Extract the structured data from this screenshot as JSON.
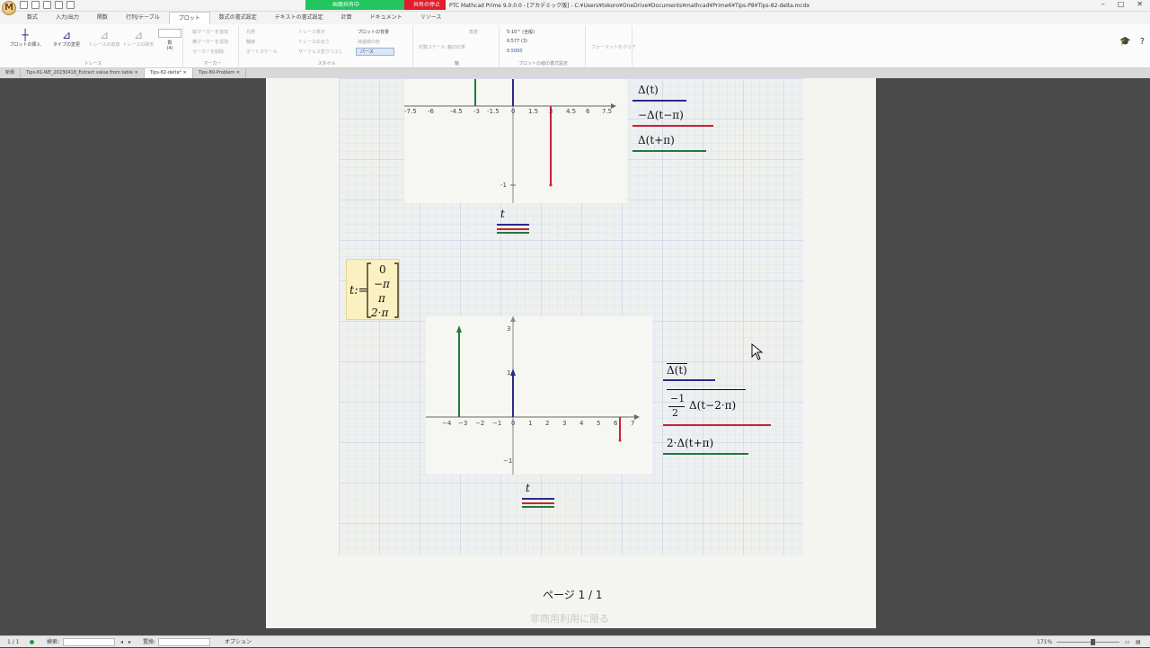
{
  "app": {
    "title": "PTC Mathcad Prime 9.0.0.0 - [アカデミック版] - C:¥Users¥tokoro¥OneDrive¥Documents¥mathcad¥Prime6¥Tips-P8¥Tips-82-delta.mcdx",
    "share_status": "画面共有中",
    "share_stop": "共有の停止"
  },
  "menu": {
    "tabs": [
      "数式",
      "入力/出力",
      "関数",
      "行列/テーブル",
      "プロット",
      "数式の書式設定",
      "テキストの書式設定",
      "計算",
      "ドキュメント",
      "リソース"
    ],
    "active": "プロット"
  },
  "ribbon": {
    "trace": {
      "insert_plot": "プロットの挿入",
      "change_type": "タイプの変更",
      "add_trace": "トレースの追加",
      "delete_trace": "トレースの除去",
      "count_label": "数",
      "count_value": "(4)",
      "group": "トレース"
    },
    "marker": {
      "add_v": "縦マーカーを追加",
      "add_h": "横マーカーを追加",
      "remove": "マーカーを削除",
      "group": "マーカー"
    },
    "style": {
      "legend": "凡例",
      "axis": "軸線",
      "auto_scale": "オートスケール",
      "trace_show": "トレース表示",
      "trace_style": "トレースの太さ",
      "surface": "サーフェス塗りつぶし",
      "plot_bg": "プロットの背景",
      "grid_line": "目盛線の色",
      "perspective": "パース",
      "group": "スタイル"
    },
    "axes": {
      "log_scale": "対数スケール",
      "equal_axes": "軸の比率",
      "angle": "角度",
      "group": "軸"
    },
    "format": {
      "font_label": "5-10^ (全般)",
      "value1": "0.577 (3)",
      "value2": "0.5000",
      "group": "プロットの値の書式設定",
      "clear_format": "フォーマットをクリア"
    }
  },
  "doc_tabs": [
    {
      "label": "新規"
    },
    {
      "label": "Tips-81-WE_20230418_Extract value from table"
    },
    {
      "label": "Tips-82-delta*",
      "active": true
    },
    {
      "label": "Tips-80-Problem"
    }
  ],
  "plot1": {
    "x_ticks": [
      "-7.5",
      "-6",
      "-4.5",
      "-3",
      "-1.5",
      "0",
      "1.5",
      "3",
      "4.5",
      "6",
      "7.5"
    ],
    "y_ticks": [
      "-1"
    ],
    "legend": [
      "Δ(t)",
      "−Δ(t−π)",
      "Δ(t+π)"
    ],
    "x_var": "t"
  },
  "definition": {
    "lhs": "t:=",
    "vector": [
      "0",
      "−π",
      "π",
      "2·π"
    ]
  },
  "plot2": {
    "x_ticks": [
      "−4",
      "−3",
      "−2",
      "−1",
      "0",
      "1",
      "2",
      "3",
      "4",
      "5",
      "6",
      "7"
    ],
    "y_ticks": [
      "3",
      "1",
      "−1"
    ],
    "legend": [
      "Δ(t)",
      "−1",
      "2",
      "Δ(t−2·π)",
      "2·Δ(t+π)"
    ],
    "x_var": "t"
  },
  "page_footer": {
    "page": "ページ 1 / 1",
    "watermark": "非商用利用に限る"
  },
  "statusbar": {
    "page": "1 / 1",
    "search": "検索:",
    "replace": "置換:",
    "options": "オプション",
    "zoom": "171%"
  },
  "colors": {
    "blue": "#2a2a8a",
    "red": "#cc2233",
    "green": "#1f7a3a",
    "share_green": "#22c55e",
    "share_red": "#e11d2a"
  }
}
